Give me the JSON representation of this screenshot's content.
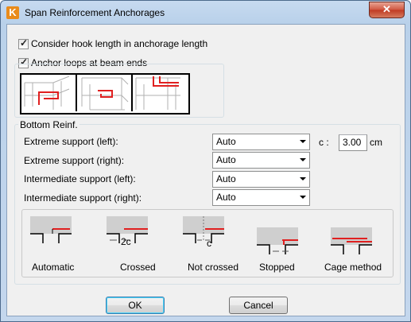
{
  "window": {
    "title": "Span Reinforcement Anchorages",
    "app_icon": "app-logo-icon",
    "close_symbol": "✕"
  },
  "options": {
    "hook_length": {
      "label": "Consider hook length in anchorage length",
      "checked": true
    },
    "anchor_loops": {
      "label": "Anchor loops at beam ends",
      "checked": true
    }
  },
  "bottom_reinf": {
    "legend": "Bottom Reinf.",
    "rows": [
      {
        "label": "Extreme support (left):",
        "value": "Auto"
      },
      {
        "label": "Extreme support (right):",
        "value": "Auto"
      },
      {
        "label": "Intermediate support (left):",
        "value": "Auto"
      },
      {
        "label": "Intermediate support (right):",
        "value": "Auto"
      }
    ],
    "c_label": "c :",
    "c_value": "3.00",
    "c_unit": "cm"
  },
  "methods": [
    {
      "label": "Automatic",
      "annotation": ""
    },
    {
      "label": "Crossed",
      "annotation": "2c"
    },
    {
      "label": "Not crossed",
      "annotation": "c"
    },
    {
      "label": "Stopped",
      "annotation": ""
    },
    {
      "label": "Cage method",
      "annotation": ""
    }
  ],
  "buttons": {
    "ok": "OK",
    "cancel": "Cancel"
  },
  "colors": {
    "rebar": "#e02020",
    "accent": "#3c7fb1"
  }
}
